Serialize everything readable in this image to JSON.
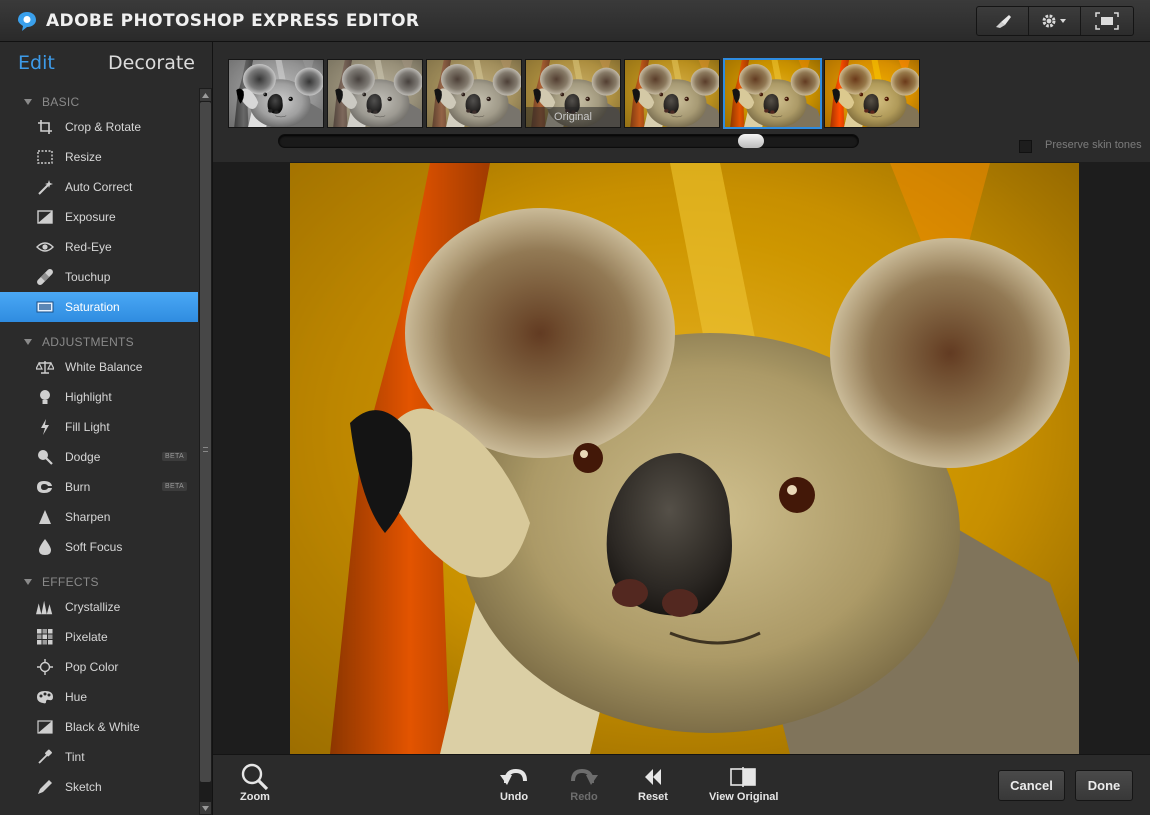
{
  "app": {
    "title": "ADOBE PHOTOSHOP EXPRESS EDITOR"
  },
  "toolbar": {
    "buttons": [
      "brush-icon",
      "settings-icon",
      "fullscreen-icon"
    ]
  },
  "modes": {
    "edit": "Edit",
    "decorate": "Decorate",
    "active": "Edit"
  },
  "sections": {
    "basic": {
      "title": "BASIC",
      "items": [
        {
          "label": "Crop & Rotate",
          "icon": "crop-icon"
        },
        {
          "label": "Resize",
          "icon": "resize-icon"
        },
        {
          "label": "Auto Correct",
          "icon": "magic-wand-icon"
        },
        {
          "label": "Exposure",
          "icon": "exposure-icon"
        },
        {
          "label": "Red-Eye",
          "icon": "eye-icon"
        },
        {
          "label": "Touchup",
          "icon": "bandage-icon"
        },
        {
          "label": "Saturation",
          "icon": "saturation-icon",
          "active": true
        }
      ]
    },
    "adjustments": {
      "title": "ADJUSTMENTS",
      "items": [
        {
          "label": "White Balance",
          "icon": "scales-icon"
        },
        {
          "label": "Highlight",
          "icon": "bulb-icon"
        },
        {
          "label": "Fill Light",
          "icon": "lightning-icon"
        },
        {
          "label": "Dodge",
          "icon": "dodge-icon",
          "badge": "BETA"
        },
        {
          "label": "Burn",
          "icon": "burn-icon",
          "badge": "BETA"
        },
        {
          "label": "Sharpen",
          "icon": "sharpen-icon"
        },
        {
          "label": "Soft Focus",
          "icon": "drop-icon"
        }
      ]
    },
    "effects": {
      "title": "EFFECTS",
      "items": [
        {
          "label": "Crystallize",
          "icon": "crystallize-icon"
        },
        {
          "label": "Pixelate",
          "icon": "pixelate-icon"
        },
        {
          "label": "Pop Color",
          "icon": "crosshair-icon"
        },
        {
          "label": "Hue",
          "icon": "palette-icon"
        },
        {
          "label": "Black & White",
          "icon": "bw-icon"
        },
        {
          "label": "Tint",
          "icon": "dropper-icon"
        },
        {
          "label": "Sketch",
          "icon": "pencil-icon"
        }
      ]
    }
  },
  "filmstrip": {
    "original_caption": "Original",
    "selected_index": 5,
    "thumbnail_saturations": [
      0.0,
      0.2,
      0.45,
      0.7,
      1.0,
      1.35,
      1.7
    ],
    "slider_value": 0.83,
    "preserve_skin_tones": {
      "label": "Preserve skin tones",
      "checked": false
    }
  },
  "bottombar": {
    "zoom": "Zoom",
    "undo": "Undo",
    "redo": "Redo",
    "reset": "Reset",
    "view_original": "View Original",
    "cancel": "Cancel",
    "done": "Done"
  },
  "colors": {
    "accent": "#2f8ce0",
    "edit_tab": "#3d9be9"
  }
}
